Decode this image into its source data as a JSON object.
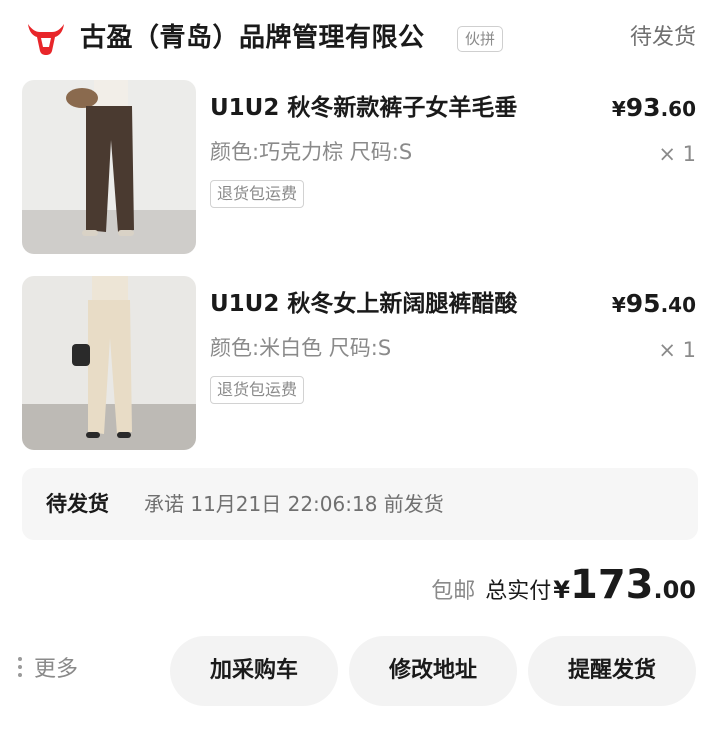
{
  "shop": {
    "name": "古盈（青岛）品牌管理有限公",
    "tag": "伙拼",
    "logo_icon": "bull-head-icon",
    "logo_color": "#e8262a"
  },
  "order": {
    "status": "待发货"
  },
  "items": [
    {
      "title": "U1U2 秋冬新款裤子女羊毛垂",
      "spec": "颜色:巧克力棕 尺码:S",
      "tag": "退货包运费",
      "price_currency": "¥",
      "price_int": "93",
      "price_dec": ".60",
      "qty": "× 1",
      "image_color": "#4a3a30"
    },
    {
      "title": "U1U2 秋冬女上新阔腿裤醋酸",
      "spec": "颜色:米白色 尺码:S",
      "tag": "退货包运费",
      "price_currency": "¥",
      "price_int": "95",
      "price_dec": ".40",
      "qty": "× 1",
      "image_color": "#e8dcc6"
    }
  ],
  "shipping": {
    "title": "待发货",
    "promise": "承诺 11月21日 22:06:18 前发货"
  },
  "total": {
    "postage": "包邮",
    "label": "总实付",
    "currency": "¥",
    "int": "173",
    "dec": ".00"
  },
  "actions": {
    "more": "更多",
    "add_cart": "加采购车",
    "modify_address": "修改地址",
    "remind_ship": "提醒发货"
  }
}
